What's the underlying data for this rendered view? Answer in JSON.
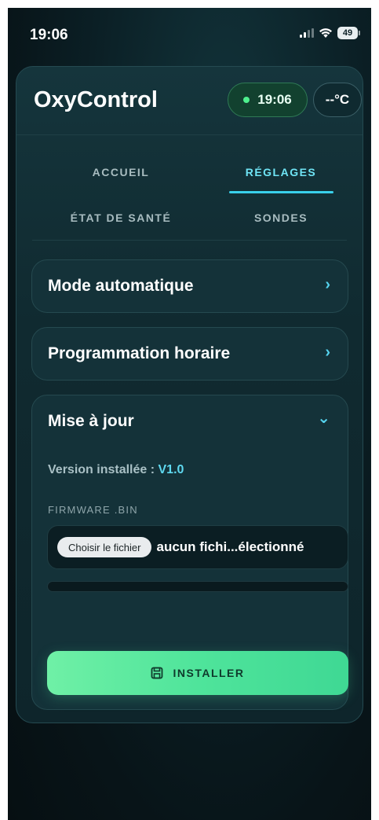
{
  "status_bar": {
    "time": "19:06",
    "battery": "49"
  },
  "app": {
    "title": "OxyControl",
    "clock": "19:06",
    "temperature": "--°C"
  },
  "tabs": [
    {
      "label": "ACCUEIL",
      "active": false
    },
    {
      "label": "RÉGLAGES",
      "active": true
    },
    {
      "label": "ÉTAT DE SANTÉ",
      "active": false
    },
    {
      "label": "SONDES",
      "active": false
    }
  ],
  "panels": {
    "auto": {
      "title": "Mode automatique",
      "chevron": "›"
    },
    "schedule": {
      "title": "Programmation horaire",
      "chevron": "›"
    },
    "update": {
      "title": "Mise à jour",
      "chevron": "⌄",
      "version_label": "Version installée : ",
      "version_value": "V1.0",
      "firmware_label": "FIRMWARE .BIN",
      "file_button": "Choisir le fichier",
      "file_name": "aucun fichi...électionné",
      "progress": 0,
      "install_label": "INSTALLER"
    }
  },
  "colors": {
    "accent": "#39d0ea",
    "success": "#4ef08e",
    "install": "#4fe49b"
  }
}
